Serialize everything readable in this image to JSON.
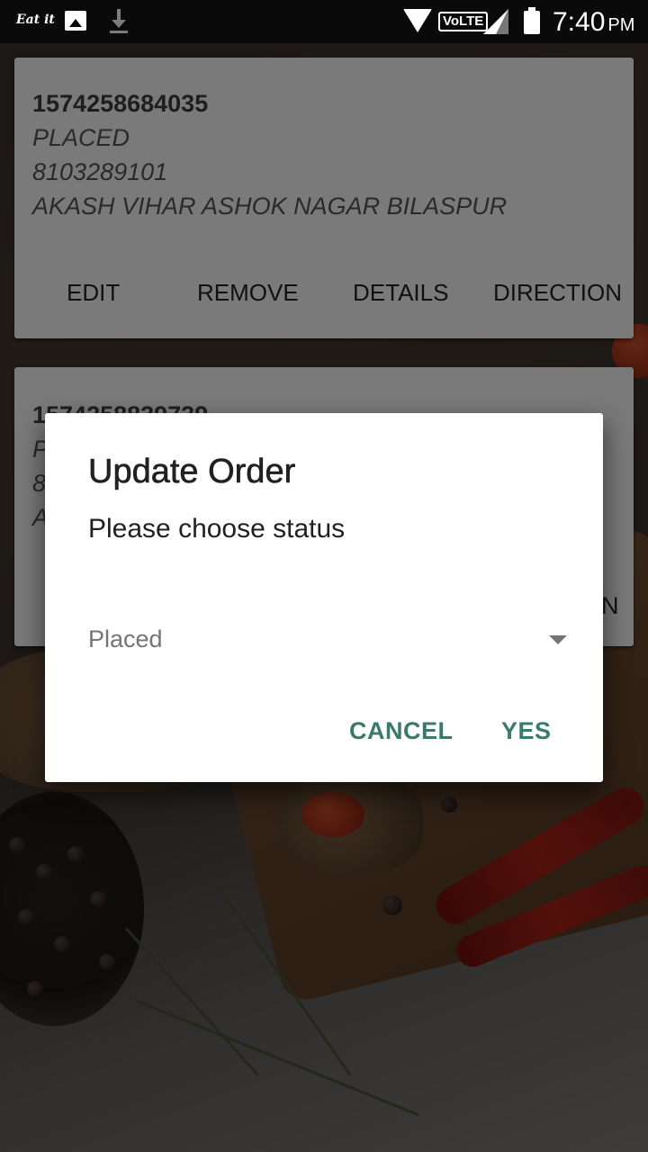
{
  "status_bar": {
    "app_notification": "Eat it",
    "network_label": "VoLTE",
    "time": "7:40",
    "ampm": "PM"
  },
  "orders": [
    {
      "id": "1574258684035",
      "status": "PLACED",
      "phone": "8103289101",
      "address": "AKASH VIHAR ASHOK NAGAR BILASPUR",
      "actions": [
        "EDIT",
        "REMOVE",
        "DETAILS",
        "DIRECTION"
      ]
    },
    {
      "id_partial": "1574258839739",
      "line2_partial": "P",
      "line3_partial": "8",
      "line4_partial": "A",
      "action_partial": "N"
    }
  ],
  "dialog": {
    "title": "Update Order",
    "message": "Please choose status",
    "spinner_value": "Placed",
    "cancel_label": "CANCEL",
    "confirm_label": "YES",
    "accent_color": "#3a7a6a"
  }
}
